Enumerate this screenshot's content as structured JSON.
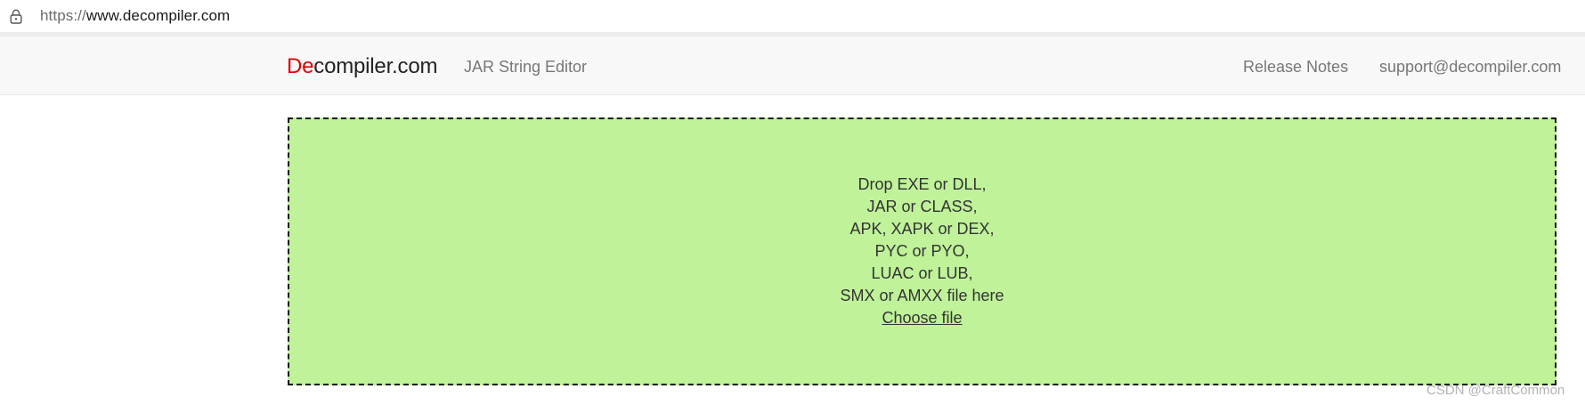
{
  "browser": {
    "url_scheme": "https://",
    "url_host": "www.decompiler.com",
    "lock_icon": "lock-icon"
  },
  "navbar": {
    "brand_prefix": "De",
    "brand_rest": "compiler.com",
    "brand_prefix_color": "#e00000",
    "left_links": [
      "JAR String Editor"
    ],
    "right_links": [
      "Release Notes",
      "support@decompiler.com"
    ]
  },
  "dropzone": {
    "lines": [
      "Drop EXE or DLL,",
      "JAR or CLASS,",
      "APK, XAPK or DEX,",
      "PYC or PYO,",
      "LUAC or LUB,",
      "SMX or AMXX file here"
    ],
    "choose_label": "Choose file",
    "background_color": "#bff299"
  },
  "watermark": "CSDN @CraftCommon"
}
